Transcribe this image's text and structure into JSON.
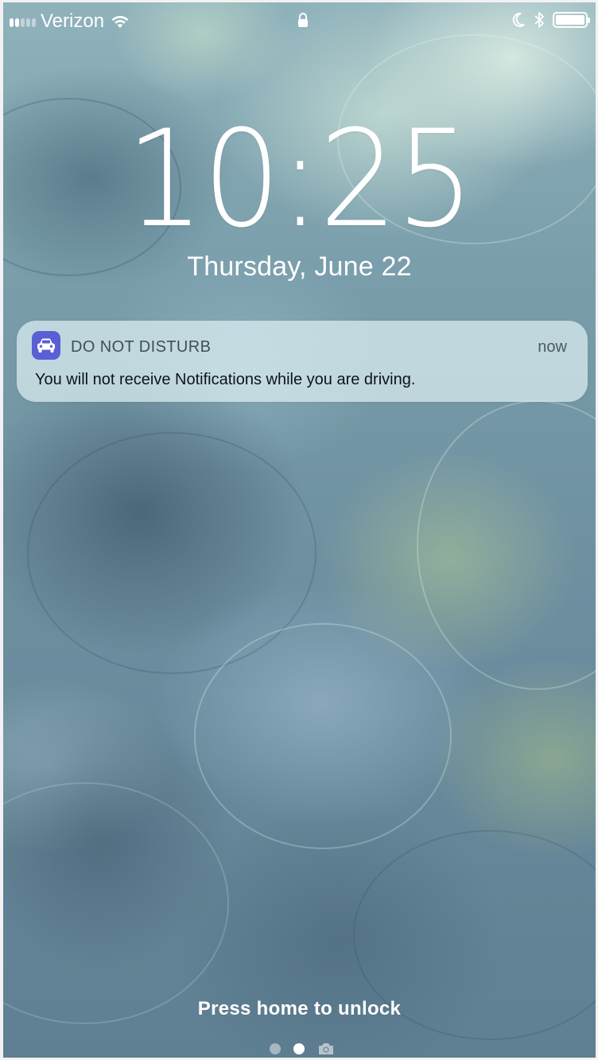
{
  "status_bar": {
    "carrier": "Verizon",
    "signal_bars_filled": 2,
    "signal_bars_total": 5,
    "icons": [
      "wifi-icon",
      "lock-icon",
      "moon-icon",
      "bluetooth-icon",
      "battery-icon"
    ],
    "battery_level": 1.0
  },
  "lock_screen": {
    "time": "10:25",
    "date": "Thursday, June 22",
    "unlock_hint": "Press home to unlock",
    "pages": {
      "count": 2,
      "active_index": 1,
      "trailing_icon": "camera-icon"
    }
  },
  "notification": {
    "app_name": "DO NOT DISTURB",
    "app_icon": "car-icon",
    "app_icon_color": "#5b5fd6",
    "time": "now",
    "body": "You will not receive Notifications while you are driving."
  }
}
